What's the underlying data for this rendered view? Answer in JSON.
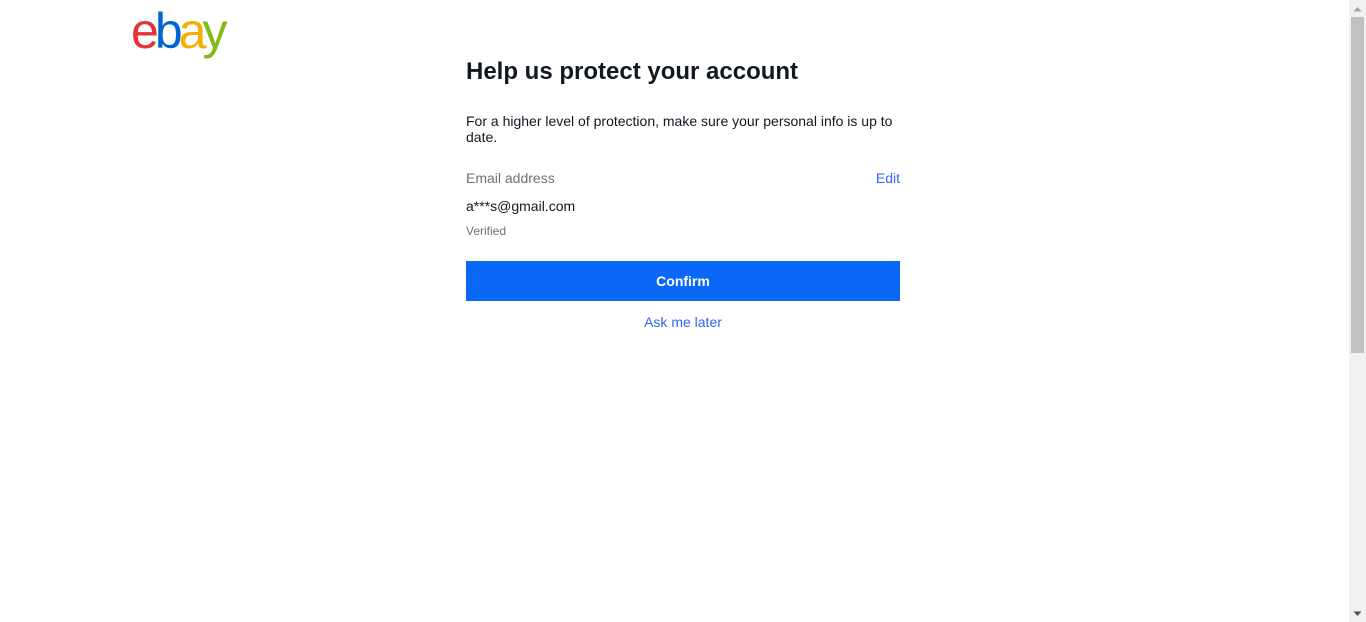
{
  "brand": {
    "name": "ebay",
    "colors": [
      "#e53238",
      "#0064d2",
      "#f5af02",
      "#86b817"
    ]
  },
  "main": {
    "title": "Help us protect your account",
    "description": "For a higher level of protection, make sure your personal info is up to date.",
    "email_field": {
      "label": "Email address",
      "edit_label": "Edit",
      "value": "a***s@gmail.com",
      "status": "Verified"
    },
    "confirm_label": "Confirm",
    "ask_later_label": "Ask me later"
  },
  "colors": {
    "primary_button": "#0968f6",
    "link": "#3665f3",
    "text": "#111820",
    "secondary_text": "#707070"
  }
}
